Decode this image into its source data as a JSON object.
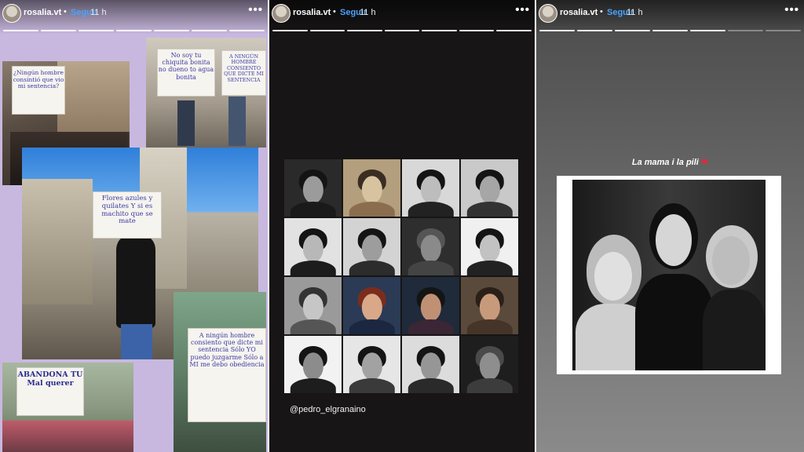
{
  "stories": [
    {
      "username": "rosalia.vt",
      "separator": "•",
      "follow_label": "Seguir",
      "time": "11 h",
      "more": "•••",
      "progress_total": 7,
      "progress_done": 7
    },
    {
      "username": "rosalia.vt",
      "separator": "•",
      "follow_label": "Seguir",
      "time": "11 h",
      "more": "•••",
      "progress_total": 7,
      "progress_done": 7
    },
    {
      "username": "rosalia.vt",
      "separator": "•",
      "follow_label": "Seguir",
      "time": "11 h",
      "more": "•••",
      "progress_total": 7,
      "progress_done": 5
    }
  ],
  "panel1": {
    "signs": [
      "¿Ningún hombre consintió que vio mi sentencia?",
      "No soy tu chiquita bonita no dueno to agua bonita",
      "A NINGÚN HOMBRE CONSIENTO QUE DICTE MI SENTENCIA",
      "Flores azules y quilates Y si es machito que se mate",
      "A ningún hombre consiento que dicte mi sentencia Sólo YO puedo juzgarme Sólo a MI me debo obediencia",
      "ABANDONA TU Mal querer"
    ]
  },
  "panel2": {
    "credit": "@pedro_elgranaino"
  },
  "panel3": {
    "caption": "La mama i la pili",
    "heart": "❤"
  },
  "colors": {
    "accent_follow": "#4aa3ff",
    "panel1_bg": "#c8b8df",
    "panel2_bg": "#171515",
    "heart": "#e0293b"
  }
}
